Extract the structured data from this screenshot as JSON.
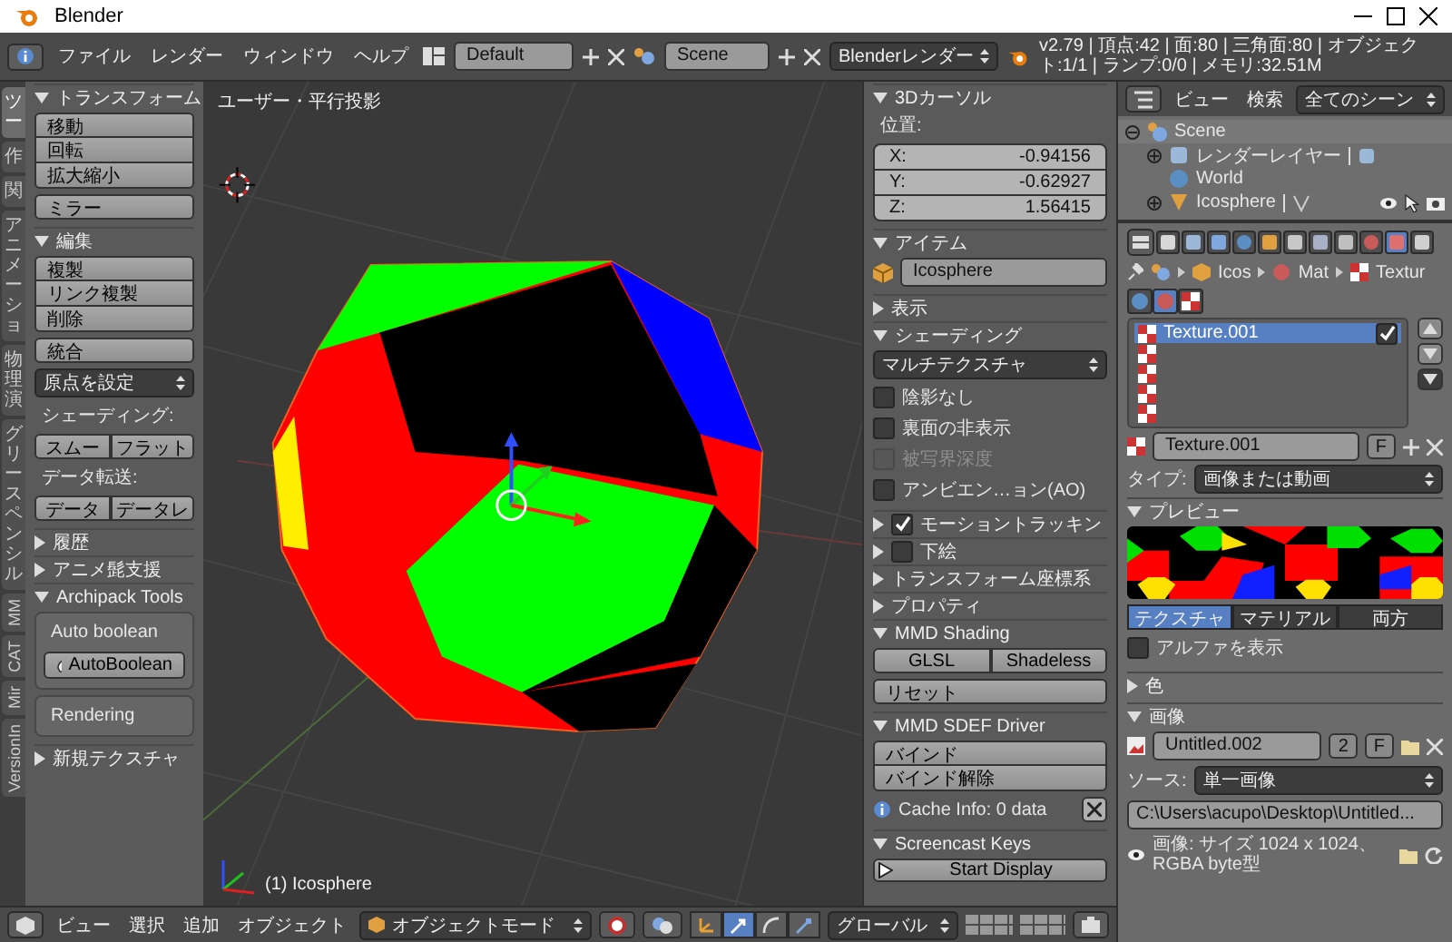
{
  "window": {
    "title": "Blender"
  },
  "info_header": {
    "menus": [
      "ファイル",
      "レンダー",
      "ウィンドウ",
      "ヘルプ"
    ],
    "layout": "Default",
    "scene": "Scene",
    "engine": "Blenderレンダー",
    "stats": "v2.79 | 頂点:42 | 面:80 | 三角面:80 | オブジェクト:1/1 | ランプ:0/0 | メモリ:32.51M"
  },
  "toolshelf": {
    "tabs": [
      {
        "label": "ツー",
        "kind": "cjk",
        "selected": true
      },
      {
        "label": "作",
        "kind": "cjk",
        "selected": false
      },
      {
        "label": "関",
        "kind": "cjk",
        "selected": false
      },
      {
        "label": "アニメーショ",
        "kind": "cjk",
        "selected": false
      },
      {
        "label": "物理演",
        "kind": "cjk",
        "selected": false
      },
      {
        "label": "グリースペンシル",
        "kind": "cjk",
        "selected": false
      },
      {
        "label": "MM",
        "kind": "latin",
        "selected": false
      },
      {
        "label": "CAT",
        "kind": "latin",
        "selected": false
      },
      {
        "label": "Mir",
        "kind": "latin",
        "selected": false
      },
      {
        "label": "VersionIn",
        "kind": "latin",
        "selected": false
      }
    ],
    "panels": [
      {
        "title": "トランスフォーム",
        "expanded": true,
        "rows": [
          {
            "kind": "buttons",
            "items": [
              "移動",
              "回転",
              "拡大縮小"
            ]
          },
          {
            "kind": "buttons",
            "items": [
              "ミラー"
            ]
          }
        ]
      },
      {
        "title": "編集",
        "expanded": true,
        "rows": [
          {
            "kind": "buttons",
            "items": [
              "複製",
              "リンク複製",
              "削除"
            ]
          },
          {
            "kind": "buttons",
            "items": [
              "統合"
            ]
          },
          {
            "kind": "dropdown",
            "value": "原点を設定"
          },
          {
            "kind": "label",
            "text": "シェーディング:"
          },
          {
            "kind": "split",
            "items": [
              "スムー",
              "フラット"
            ]
          },
          {
            "kind": "label",
            "text": "データ転送:"
          },
          {
            "kind": "split",
            "items": [
              "データ",
              "データレ"
            ]
          }
        ]
      },
      {
        "title": "履歴",
        "expanded": false
      },
      {
        "title": "アニメ髭支援",
        "expanded": false
      },
      {
        "title": "Archipack Tools",
        "expanded": true,
        "rows": [
          {
            "kind": "box",
            "label": "Auto boolean",
            "button": "AutoBoolean"
          },
          {
            "kind": "box",
            "label": "Rendering"
          }
        ]
      },
      {
        "title": "新規テクスチャ",
        "expanded": false
      }
    ]
  },
  "viewport": {
    "view_label": "ユーザー・平行投影",
    "object_label": "(1) Icosphere"
  },
  "npanel": {
    "panels": [
      {
        "title": "3Dカーソル",
        "expanded": true,
        "rows": [
          {
            "kind": "label",
            "text": "位置:"
          },
          {
            "kind": "fields",
            "items": [
              {
                "label": "X:",
                "value": "-0.94156"
              },
              {
                "label": "Y:",
                "value": "-0.62927"
              },
              {
                "label": "Z:",
                "value": "1.56415"
              }
            ]
          }
        ]
      },
      {
        "title": "アイテム",
        "expanded": true,
        "rows": [
          {
            "kind": "object",
            "value": "Icosphere"
          }
        ]
      },
      {
        "title": "表示",
        "expanded": false
      },
      {
        "title": "シェーディング",
        "expanded": true,
        "rows": [
          {
            "kind": "dropdown",
            "value": "マルチテクスチャ"
          },
          {
            "kind": "check",
            "label": "陰影なし",
            "checked": false,
            "disabled": false
          },
          {
            "kind": "check",
            "label": "裏面の非表示",
            "checked": false,
            "disabled": false
          },
          {
            "kind": "check",
            "label": "被写界深度",
            "checked": false,
            "disabled": true
          },
          {
            "kind": "check",
            "label": "アンビエン…ョン(AO)",
            "checked": false,
            "disabled": false
          }
        ]
      },
      {
        "title": "モーショントラッキン",
        "expanded": false,
        "checked": true
      },
      {
        "title": "下絵",
        "expanded": false,
        "checked": false
      },
      {
        "title": "トランスフォーム座標系",
        "expanded": false
      },
      {
        "title": "プロパティ",
        "expanded": false
      },
      {
        "title": "MMD Shading",
        "expanded": true,
        "rows": [
          {
            "kind": "split",
            "items": [
              "GLSL",
              "Shadeless"
            ]
          },
          {
            "kind": "buttons",
            "items": [
              "リセット"
            ]
          }
        ]
      },
      {
        "title": "MMD SDEF Driver",
        "expanded": true,
        "rows": [
          {
            "kind": "buttons",
            "items": [
              "バインド",
              "バインド解除"
            ]
          },
          {
            "kind": "info",
            "text": "Cache Info: 0 data"
          }
        ]
      },
      {
        "title": "Screencast Keys",
        "expanded": true,
        "rows": [
          {
            "kind": "play",
            "label": "Start Display"
          }
        ]
      }
    ]
  },
  "view_header": {
    "menus": [
      "ビュー",
      "選択",
      "追加",
      "オブジェクト"
    ],
    "mode": "オブジェクトモード",
    "orientation": "グローバル"
  },
  "outliner": {
    "menus": [
      "ビュー",
      "検索"
    ],
    "filter": "全てのシーン",
    "tree": [
      {
        "label": "Scene",
        "kind": "scene",
        "expanded": true,
        "children": [
          {
            "label": "レンダーレイヤー",
            "kind": "layers",
            "expanded": false
          },
          {
            "label": "World",
            "kind": "world"
          },
          {
            "label": "Icosphere",
            "kind": "mesh",
            "expanded": false
          }
        ]
      }
    ]
  },
  "properties": {
    "tabs": [
      {
        "kind": "render",
        "selected": false
      },
      {
        "kind": "layers",
        "selected": false
      },
      {
        "kind": "scene",
        "selected": false
      },
      {
        "kind": "world",
        "selected": false
      },
      {
        "kind": "object",
        "selected": false
      },
      {
        "kind": "constraints",
        "selected": false
      },
      {
        "kind": "modifiers",
        "selected": false
      },
      {
        "kind": "data",
        "selected": false
      },
      {
        "kind": "material",
        "selected": false
      },
      {
        "kind": "texture",
        "selected": true
      },
      {
        "kind": "particles",
        "selected": false
      }
    ],
    "breadcrumb": [
      {
        "kind": "object",
        "label": "Icos"
      },
      {
        "kind": "material",
        "label": "Mat"
      },
      {
        "kind": "texture",
        "label": "Textur"
      }
    ],
    "texture_types": [
      {
        "kind": "world",
        "selected": false
      },
      {
        "kind": "material",
        "selected": true
      },
      {
        "kind": "texture",
        "selected": false
      }
    ],
    "slots": [
      {
        "label": "Texture.001",
        "selected": true,
        "checked": true
      },
      {
        "selected": false
      },
      {
        "selected": false
      },
      {
        "selected": false
      },
      {
        "selected": false
      }
    ],
    "texture_name": "Texture.001",
    "fake_user": "F",
    "type_label": "タイプ:",
    "type": "画像または動画",
    "panels": [
      {
        "kind": "preview",
        "title": "プレビュー",
        "expanded": true,
        "tabs": [
          {
            "label": "テクスチャ",
            "selected": true
          },
          {
            "label": "マテリアル",
            "selected": false
          },
          {
            "label": "両方",
            "selected": false
          }
        ],
        "alpha": {
          "label": "アルファを表示",
          "checked": false
        }
      },
      {
        "title": "色",
        "expanded": false
      },
      {
        "kind": "image",
        "title": "画像",
        "expanded": true,
        "image": "Untitled.002",
        "users": "2",
        "fake_user": "F",
        "source_label": "ソース:",
        "source": "単一画像",
        "path": "C:\\Users\\acupo\\Desktop\\Untitled...",
        "info": "画像: サイズ 1024 x 1024、 RGBA byte型"
      }
    ]
  }
}
